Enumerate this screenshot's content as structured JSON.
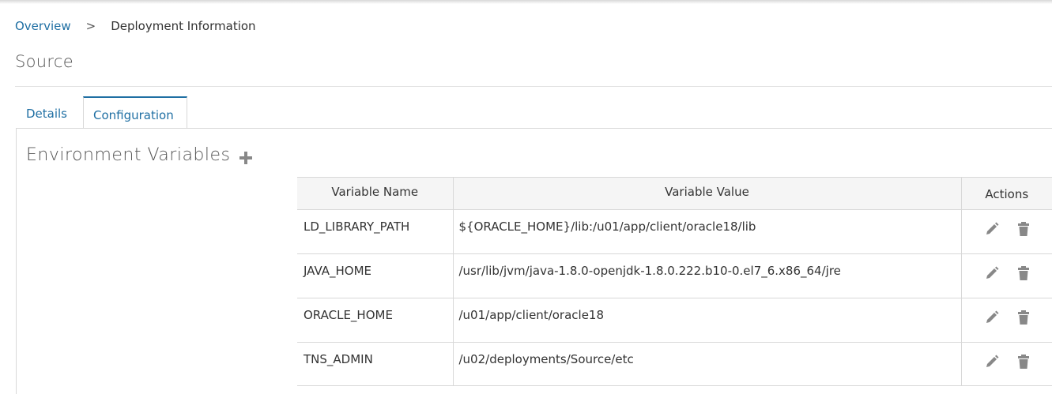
{
  "breadcrumb": {
    "overview": "Overview",
    "separator": ">",
    "current": "Deployment Information"
  },
  "page_title": "Source",
  "tabs": [
    {
      "label": "Details",
      "active": false
    },
    {
      "label": "Configuration",
      "active": true
    }
  ],
  "section": {
    "title": "Environment Variables",
    "add_icon": "plus-icon"
  },
  "table": {
    "headers": {
      "name": "Variable Name",
      "value": "Variable Value",
      "actions": "Actions"
    },
    "rows": [
      {
        "name": "LD_LIBRARY_PATH",
        "value": "${ORACLE_HOME}/lib:/u01/app/client/oracle18/lib"
      },
      {
        "name": "JAVA_HOME",
        "value": "/usr/lib/jvm/java-1.8.0-openjdk-1.8.0.222.b10-0.el7_6.x86_64/jre"
      },
      {
        "name": "ORACLE_HOME",
        "value": "/u01/app/client/oracle18"
      },
      {
        "name": "TNS_ADMIN",
        "value": "/u02/deployments/Source/etc"
      }
    ],
    "row_action_icons": [
      "pencil-icon",
      "trash-icon"
    ]
  },
  "colors": {
    "link": "#1f6fa3",
    "icon": "#888888",
    "border": "#d8d8d8",
    "header_bg": "#f5f5f5"
  }
}
